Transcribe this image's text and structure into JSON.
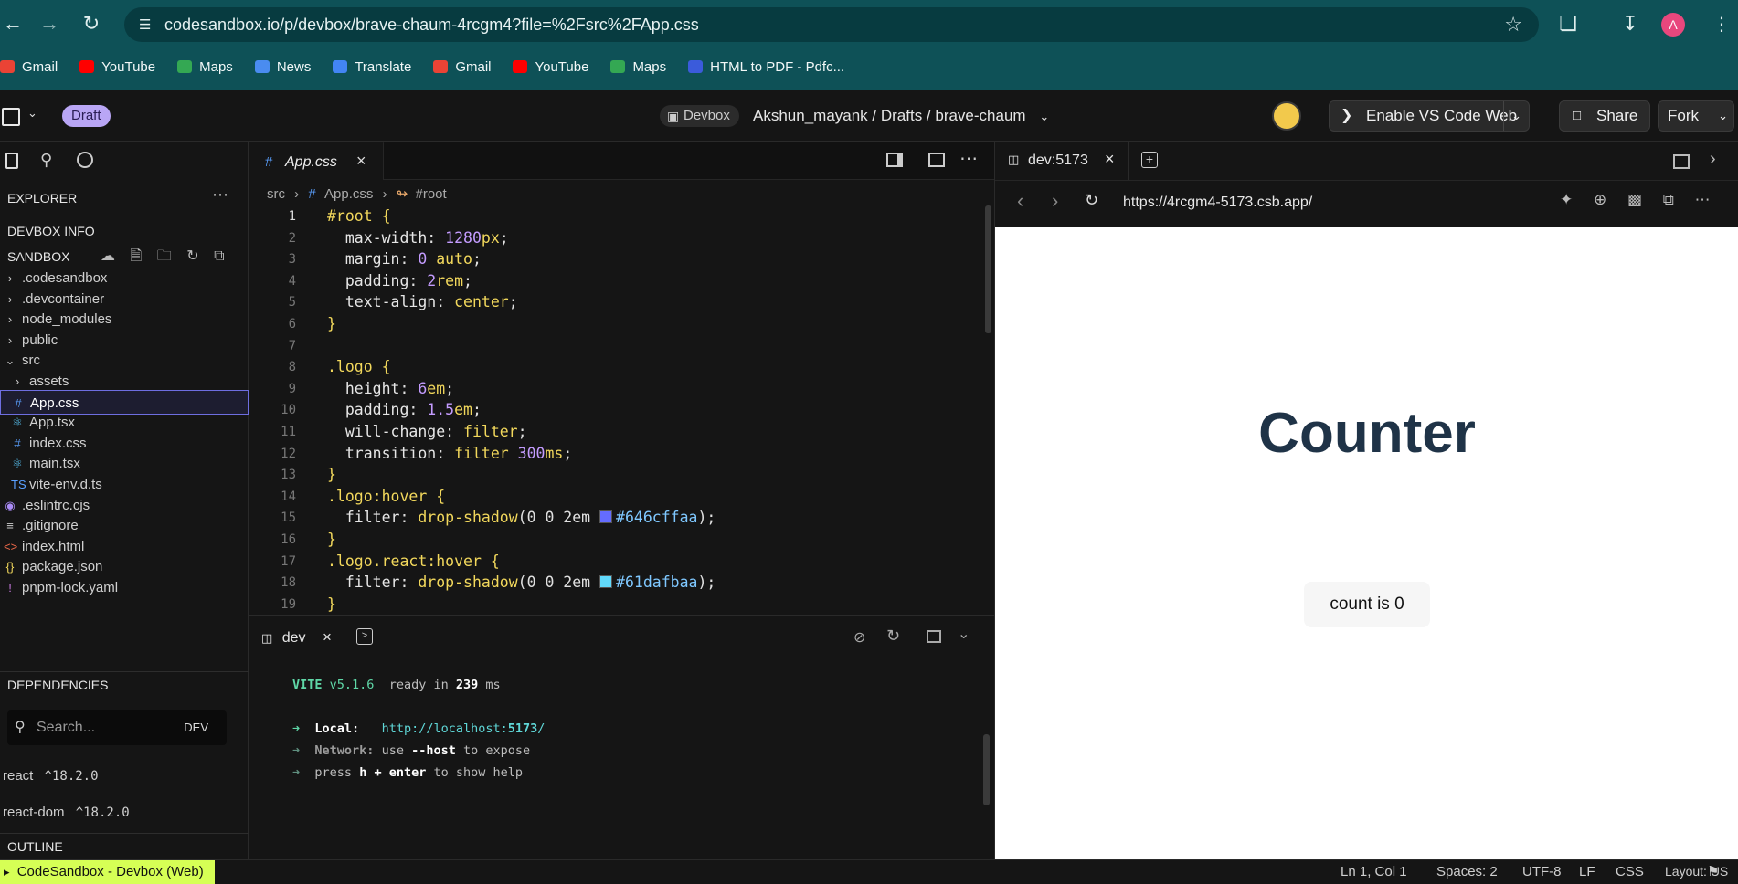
{
  "browser": {
    "url": "codesandbox.io/p/devbox/brave-chaum-4rcgm4?file=%2Fsrc%2FApp.css",
    "avatar_letter": "A",
    "bookmarks": [
      {
        "label": "Gmail",
        "icon": "gmail-icon",
        "color": "#ea4335"
      },
      {
        "label": "YouTube",
        "icon": "youtube-icon",
        "color": "#ff0000"
      },
      {
        "label": "Maps",
        "icon": "maps-icon",
        "color": "#34a853"
      },
      {
        "label": "News",
        "icon": "news-icon",
        "color": "#4a8cf0"
      },
      {
        "label": "Translate",
        "icon": "translate-icon",
        "color": "#4285f4"
      },
      {
        "label": "Gmail",
        "icon": "gmail-icon",
        "color": "#ea4335"
      },
      {
        "label": "YouTube",
        "icon": "youtube-icon",
        "color": "#ff0000"
      },
      {
        "label": "Maps",
        "icon": "maps-icon",
        "color": "#34a853"
      },
      {
        "label": "HTML to PDF - Pdfc...",
        "icon": "pdf-chart-icon",
        "color": "#3b5bdb"
      }
    ]
  },
  "app_header": {
    "draft_label": "Draft",
    "devbox_label": "Devbox",
    "crumbs": "Akshun_mayank / Drafts / brave-chaum",
    "enable_vscode_label": "Enable VS Code Web",
    "share_label": "Share",
    "fork_label": "Fork"
  },
  "sidebar": {
    "explorer_title": "EXPLORER",
    "devbox_info_title": "DEVBOX INFO",
    "sandbox_title": "SANDBOX",
    "items": [
      {
        "label": ".codesandbox",
        "kind": "folder",
        "expanded": false
      },
      {
        "label": ".devcontainer",
        "kind": "folder",
        "expanded": false
      },
      {
        "label": "node_modules",
        "kind": "folder",
        "expanded": false
      },
      {
        "label": "public",
        "kind": "folder",
        "expanded": false
      },
      {
        "label": "src",
        "kind": "folder",
        "expanded": true
      },
      {
        "label": "assets",
        "kind": "folder",
        "expanded": false
      },
      {
        "label": "App.css",
        "kind": "css",
        "selected": true
      },
      {
        "label": "App.tsx",
        "kind": "react"
      },
      {
        "label": "index.css",
        "kind": "css"
      },
      {
        "label": "main.tsx",
        "kind": "react"
      },
      {
        "label": "vite-env.d.ts",
        "kind": "ts"
      },
      {
        "label": ".eslintrc.cjs",
        "kind": "eslint"
      },
      {
        "label": ".gitignore",
        "kind": "git"
      },
      {
        "label": "index.html",
        "kind": "html"
      },
      {
        "label": "package.json",
        "kind": "json"
      },
      {
        "label": "pnpm-lock.yaml",
        "kind": "yaml"
      }
    ],
    "dependencies_title": "DEPENDENCIES",
    "search_placeholder": "Search...",
    "dev_toggle": "DEV",
    "dependencies": [
      {
        "name": "react",
        "version": "^18.2.0"
      },
      {
        "name": "react-dom",
        "version": "^18.2.0"
      }
    ],
    "outline_title": "OUTLINE"
  },
  "editor": {
    "tab_label": "App.css",
    "breadcrumb_src": "src",
    "breadcrumb_file": "App.css",
    "breadcrumb_symbol": "#root",
    "lines": [
      {
        "n": "1"
      },
      {
        "n": "2"
      },
      {
        "n": "3"
      },
      {
        "n": "4"
      },
      {
        "n": "5"
      },
      {
        "n": "6"
      },
      {
        "n": "7"
      },
      {
        "n": "8"
      },
      {
        "n": "9"
      },
      {
        "n": "10"
      },
      {
        "n": "11"
      },
      {
        "n": "12"
      },
      {
        "n": "13"
      },
      {
        "n": "14"
      },
      {
        "n": "15"
      },
      {
        "n": "16"
      },
      {
        "n": "17"
      },
      {
        "n": "18"
      },
      {
        "n": "19"
      }
    ],
    "code": {
      "l1_sel": "#root",
      "l1_brace": " {",
      "l2_prop": "  max-width",
      "l2_num": "1280",
      "l2_unit": "px",
      "l3_prop": "  margin",
      "l3_num": "0",
      "l3_val": "auto",
      "l4_prop": "  padding",
      "l4_num": "2",
      "l4_unit": "rem",
      "l5_prop": "  text-align",
      "l5_val": "center",
      "l6": "}",
      "l8_sel": ".logo",
      "l8_brace": " {",
      "l9_prop": "  height",
      "l9_num": "6",
      "l9_unit": "em",
      "l10_prop": "  padding",
      "l10_num": "1.5",
      "l10_unit": "em",
      "l11_prop": "  will-change",
      "l11_val": "filter",
      "l12_prop": "  transition",
      "l12_val": "filter",
      "l12_num": "300",
      "l12_unit": "ms",
      "l13": "}",
      "l14_sel": ".logo",
      "l14_pseudo": ":hover",
      "l14_brace": " {",
      "l15_prop": "  filter",
      "l15_fn": "drop-shadow",
      "l15_args": "(0 0 2em ",
      "l15_hex": "#646cffaa",
      "l15_swatch": "#646cff",
      "l16": "}",
      "l17_sel": ".logo.react",
      "l17_pseudo": ":hover",
      "l17_brace": " {",
      "l18_prop": "  filter",
      "l18_fn": "drop-shadow",
      "l18_args": "(0 0 2em ",
      "l18_hex": "#61dafbaa",
      "l18_swatch": "#61dafb",
      "l19": "}"
    }
  },
  "terminal": {
    "tab_label": "dev",
    "vite_name": "VITE",
    "vite_version": "v5.1.6",
    "ready_text": "ready in",
    "ready_ms": "239",
    "ms_unit": "ms",
    "local_label": "Local:",
    "local_url_base": "http://localhost:",
    "local_port": "5173",
    "local_slash": "/",
    "network_label": "Network:",
    "network_text_a": "use",
    "network_flag": "--host",
    "network_text_b": "to expose",
    "help_a": "press",
    "help_key": "h + enter",
    "help_b": "to show help"
  },
  "preview": {
    "tab_label": "dev:5173",
    "url": "https://4rcgm4-5173.csb.app/",
    "heading": "Counter",
    "button_label": "count is 0"
  },
  "statusbar": {
    "left_label": "CodeSandbox - Devbox (Web)",
    "position": "Ln 1, Col 1",
    "spaces": "Spaces: 2",
    "encoding": "UTF-8",
    "eol": "LF",
    "language": "CSS",
    "layout": "Layout: US"
  },
  "colors": {
    "chrome_bg": "#0e5157",
    "app_bg": "#151515",
    "accent_selection": "#6e6ee0",
    "status_accent": "#d6ff55",
    "heading_color": "#1f3347"
  }
}
